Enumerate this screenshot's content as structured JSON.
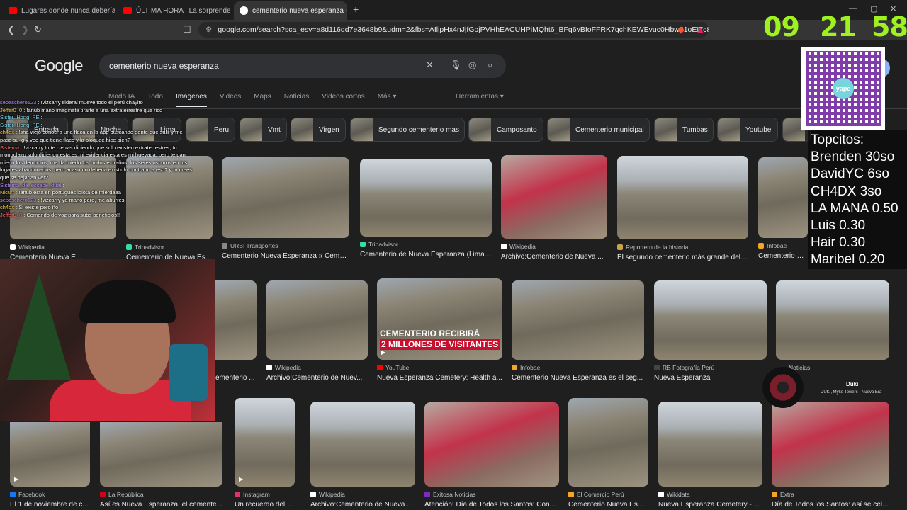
{
  "browser": {
    "tabs": [
      {
        "label": "Lugares donde nunca deberías grab"
      },
      {
        "label": "ÚLTIMA HORA | La sorprendente rev"
      },
      {
        "label": "cementerio nueva esperanza - B"
      }
    ],
    "new_tab": "+",
    "url": "google.com/search?sca_esv=a8d116dd7e3648b9&udm=2&fbs=AIljpHx4nJjfGojPVHhEACUHPiMQht6_BFq6vBIoFFRK7qchKEWEvuc0Hbw31oEI7c8o3y..."
  },
  "google": {
    "logo": "Google",
    "query": "cementerio nueva esperanza",
    "tabs": [
      "Modo IA",
      "Todo",
      "Imágenes",
      "Videos",
      "Maps",
      "Noticias",
      "Videos cortos",
      "Más ▾"
    ],
    "tools": "Herramientas ▾",
    "chips": [
      "Entrada",
      "Noche",
      "Lima",
      "Peru",
      "Vmt",
      "Virgen",
      "Segundo cementerio mas",
      "Camposanto",
      "Cementerio municipal",
      "Tumbas",
      "Youtube"
    ]
  },
  "results": {
    "row1": [
      {
        "source": "Wikipedia",
        "title": "Cementerio Nueva E..."
      },
      {
        "source": "Tripadvisor",
        "title": "Cementerio de Nueva Es..."
      },
      {
        "source": "URBI Transportes",
        "title": "Cementerio Nueva Esperanza » Ceme..."
      },
      {
        "source": "Tripadvisor",
        "title": "Cementerio de Nueva Esperanza (Lima..."
      },
      {
        "source": "Wikipedia",
        "title": "Archivo:Cementerio de Nueva ..."
      },
      {
        "source": "Reportero de la historia",
        "title": "El segundo cementerio más grande del ..."
      },
      {
        "source": "Infobae",
        "title": "Cementerio Nue..."
      }
    ],
    "row2": [
      {
        "source": "",
        "title": "ementerio ..."
      },
      {
        "source": "Wikipedia",
        "title": "Archivo:Cementerio de Nuev..."
      },
      {
        "source": "YouTube",
        "title": "Nueva Esperanza Cemetery: Health a...",
        "banner1": "CEMENTERIO RECIBIRÁ",
        "banner2": "2 MILLONES DE VISITANTES"
      },
      {
        "source": "Infobae",
        "title": "Cementerio Nueva Esperanza es el seg..."
      },
      {
        "source": "RB Fotografía Perú",
        "title": "Nueva Esperanza"
      },
      {
        "source": "Noticias",
        "title": ""
      }
    ],
    "row3": [
      {
        "source": "Facebook",
        "title": "El 1 de noviembre de c..."
      },
      {
        "source": "La República",
        "title": "Así es Nueva Esperanza, el cemente..."
      },
      {
        "source": "Instagram",
        "title": "Un recuerdo del ce..."
      },
      {
        "source": "Wikipedia",
        "title": "Archivo:Cementerio de Nueva ..."
      },
      {
        "source": "Exitosa Noticias",
        "title": "Atención! Día de Todos los Santos: Con..."
      },
      {
        "source": "El Comercio Perú",
        "title": "Cementerio Nueva Es..."
      },
      {
        "source": "Wikidata",
        "title": "Nueva Esperanza Cemetery - ..."
      },
      {
        "source": "Extra",
        "title": "Día de Todos los Santos: así se cel..."
      }
    ]
  },
  "chat": [
    {
      "user": "sebaschero123",
      "msg": " : !vizcarry sideral mueve todo el perú chayito",
      "cls": "u1"
    },
    {
      "user": "Jeffer0_0",
      "msg": " : !anub mano imaginate tirarte a una extraterrestre que rico",
      "cls": "u2"
    },
    {
      "user": "Sister_Hong_PE",
      "msg": " :",
      "cls": "u4"
    },
    {
      "user": "Sister_Hong_PE",
      "msg": " :",
      "cls": "u4"
    },
    {
      "user": "ch4dx",
      "msg": " : !sha viejo conoci a una flaca en la app buscando gente que salir y me",
      "cls": "u2"
    },
    {
      "user": "",
      "msg": "paso su ig y veo que tiene flaco y la bloquee hice bien?",
      "cls": ""
    },
    {
      "user": "Sistema",
      "msg": " : !vizcarry tu te cierras diciendo que solo existen extraterrestres, tu",
      "cls": "u3"
    },
    {
      "user": "",
      "msg": "mongolazo solo diciendo esta es mi evidencia esta es mi huevada, pero te dan",
      "cls": ""
    },
    {
      "user": "",
      "msg": "miedo los demonios, me da miedo los ruidos extraños, los seres oscuros en tus",
      "cls": ""
    },
    {
      "user": "",
      "msg": "lugares abandonados, pero acaso no deberia existir lo contrario a eso? y tu crees",
      "cls": ""
    },
    {
      "user": "",
      "msg": "que se dejarian ver?",
      "cls": ""
    },
    {
      "user": "Sistema_de_escape_dual",
      "msg": " :",
      "cls": "u1"
    },
    {
      "user": "Nicurr",
      "msg": " : !anub esta en portugues idiota de mierdaaa",
      "cls": "u2"
    },
    {
      "user": "sebaschero123",
      "msg": " : !vizcarry ya mano pero, me aburres",
      "cls": "u1"
    },
    {
      "user": "ch4dx",
      "msg": " : Si existe pero ño",
      "cls": "u2"
    },
    {
      "user": "Jeffer0_0",
      "msg": " : Comando de voz para subs beneficios!!",
      "cls": "u3"
    }
  ],
  "stream": {
    "clock": [
      "09",
      "21",
      "58"
    ],
    "qr_label": "yape",
    "top_list": [
      "Topcitos:",
      "Brenden 30so",
      "DavidYC 6so",
      "CH4DX 3so",
      "LA MANA 0.50",
      "Luis 0.30",
      "Hair 0.30",
      "Maribel 0.20"
    ],
    "music_title": "Duki",
    "music_artist": "DUKI, Myke Towers - Nueva Era"
  },
  "colors": {
    "accent_green": "#9df220",
    "bg": "#1f1f1f"
  }
}
